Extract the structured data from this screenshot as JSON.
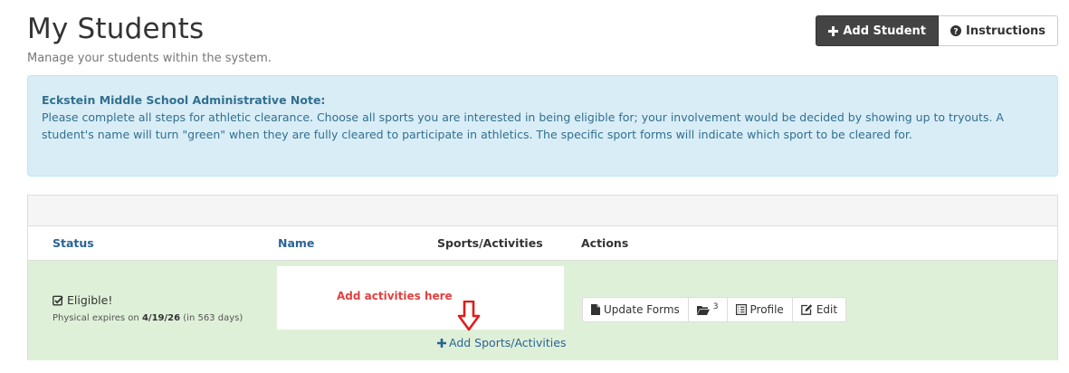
{
  "header": {
    "title": "My Students",
    "subtitle": "Manage your students within the system.",
    "add_student_label": "Add Student",
    "instructions_label": "Instructions"
  },
  "note": {
    "title": "Eckstein Middle School Administrative Note:",
    "body": "Please complete all steps for athletic clearance. Choose all sports you are interested in being eligible for; your involvement would be decided by showing up to tryouts. A student's name will turn \"green\" when they are fully cleared to participate in athletics. The specific sport forms will indicate which sport to be cleared for."
  },
  "table": {
    "columns": {
      "status": "Status",
      "name": "Name",
      "sports": "Sports/Activities",
      "actions": "Actions"
    },
    "row": {
      "status": "Eligible!",
      "expires_prefix": "Physical expires on",
      "expires_date": "4/19/26",
      "expires_suffix": "(in 563 days)",
      "annotation": "Add activities here",
      "add_sports_label": "Add Sports/Activities",
      "actions": {
        "update_forms": "Update Forms",
        "folder_count": "3",
        "profile": "Profile",
        "edit": "Edit"
      }
    }
  },
  "colors": {
    "info_bg": "#d9edf7",
    "success_bg": "#dff0d8",
    "link": "#2a6496",
    "annotation": "#e34040"
  }
}
